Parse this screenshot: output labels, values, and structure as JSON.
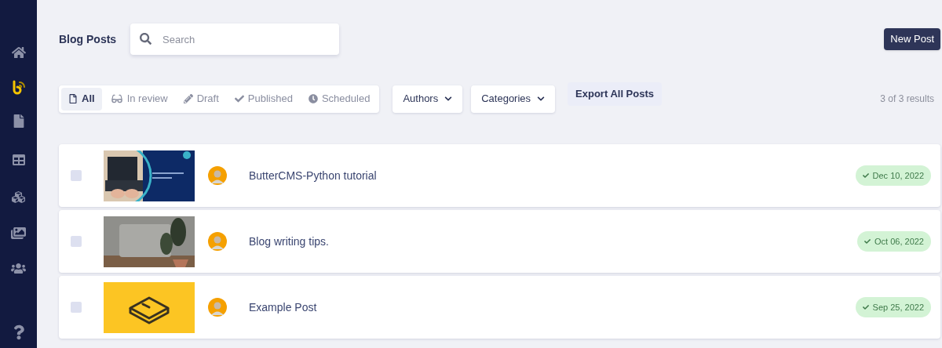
{
  "header": {
    "title": "Blog Posts",
    "search": {
      "placeholder": "Search"
    },
    "new_button": "New Post"
  },
  "status_tabs": [
    {
      "label": "All",
      "kind": "all",
      "selected": true
    },
    {
      "label": "In review",
      "kind": "review",
      "selected": false
    },
    {
      "label": "Draft",
      "kind": "draft",
      "selected": false
    },
    {
      "label": "Published",
      "kind": "published",
      "selected": false
    },
    {
      "label": "Scheduled",
      "kind": "scheduled",
      "selected": false
    }
  ],
  "filters": [
    "Authors",
    "Categories"
  ],
  "export_button": "Export All Posts",
  "result_count": "3 of 3 results",
  "posts": [
    {
      "title": "ButterCMS-Python tutorial",
      "checked": false,
      "date": "Dec 10, 2022"
    },
    {
      "title": "Blog writing tips.",
      "checked": false,
      "date": "Oct 06, 2022"
    },
    {
      "title": "Example Post",
      "checked": false,
      "date": "Sep 25, 2022"
    }
  ]
}
